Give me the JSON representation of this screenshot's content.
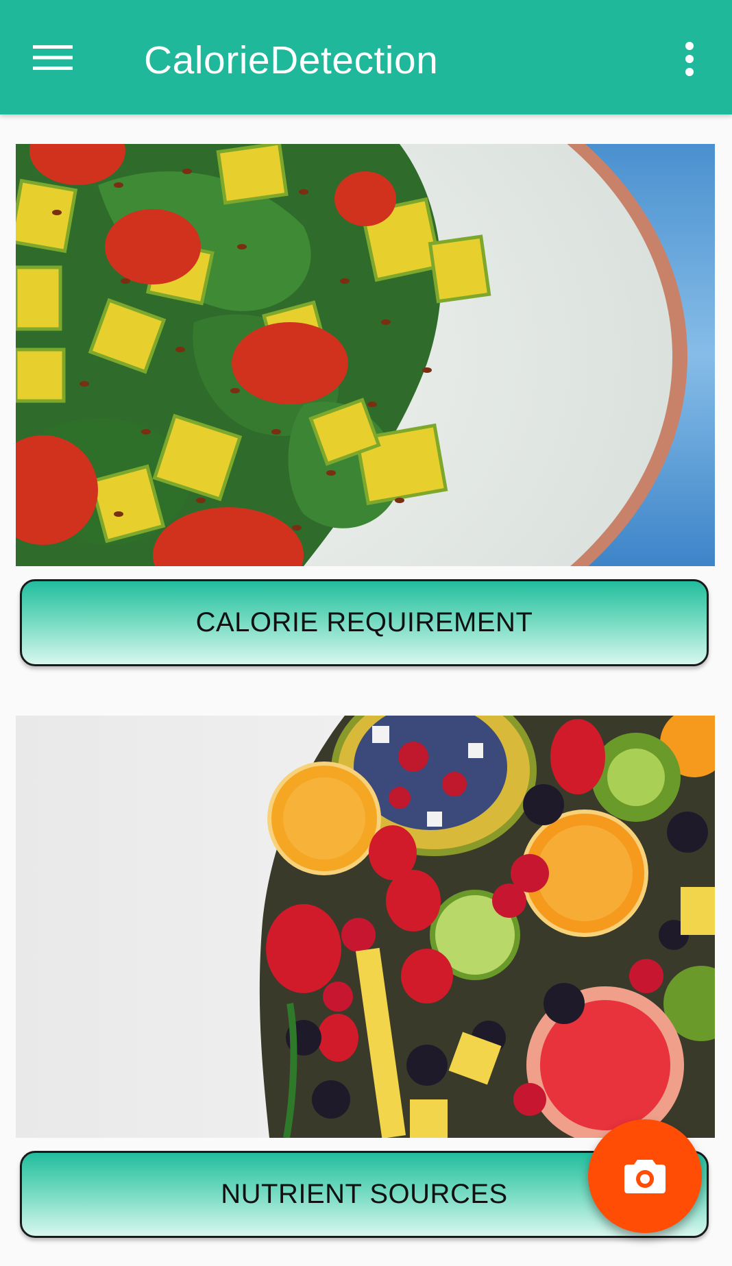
{
  "app_bar": {
    "title": "CalorieDetection",
    "background_color": "#20b89a",
    "menu_icon": "hamburger-menu-icon",
    "overflow_icon": "more-vert-icon"
  },
  "sections": [
    {
      "image": "salad-bowl-image",
      "button_label": "CALORIE REQUIREMENT"
    },
    {
      "image": "fruit-platter-image",
      "button_label": "NUTRIENT SOURCES"
    }
  ],
  "fab": {
    "icon": "camera-icon",
    "color": "#ff4d06"
  }
}
